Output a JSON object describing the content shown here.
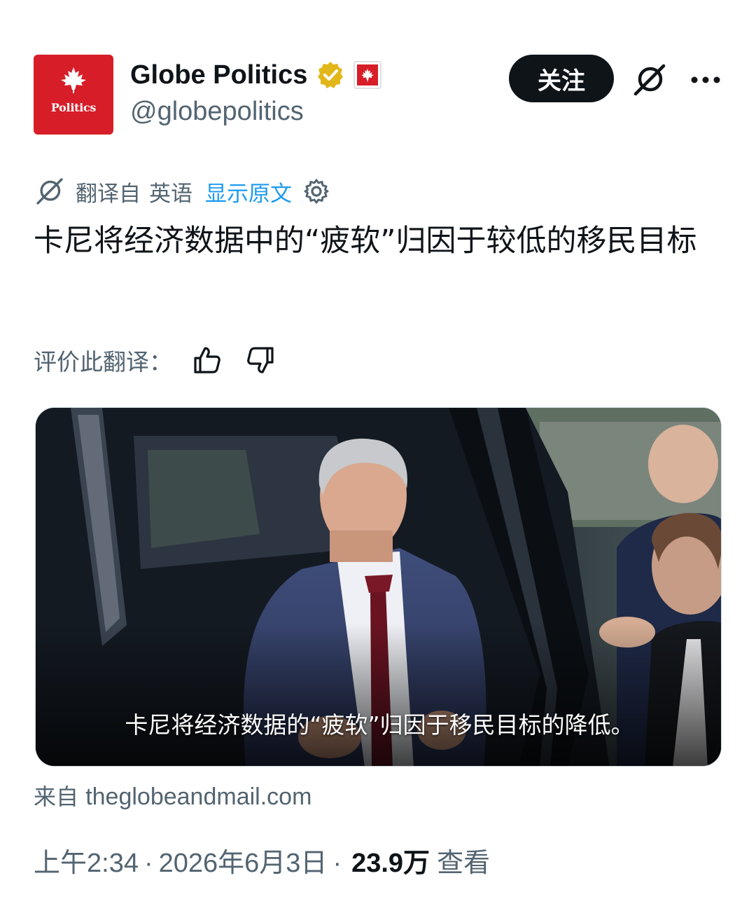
{
  "account": {
    "avatar_text": "Politics",
    "display_name": "Globe Politics",
    "handle": "@globepolitics",
    "verified_icon": "verified-badge-gold",
    "affiliate_icon": "canada-flag-badge",
    "brand_color": "#d71e28"
  },
  "actions": {
    "follow_label": "关注",
    "grok_icon": "grok-icon",
    "more_icon": "more-icon"
  },
  "translation": {
    "translated_from": "翻译自",
    "language": "英语",
    "show_original": "显示原文",
    "settings_icon": "gear-icon"
  },
  "post": {
    "text": "卡尼将经济数据中的“疲软”归因于较低的移民目标"
  },
  "rating": {
    "label": "评价此翻译：",
    "thumbs_up_icon": "thumbs-up-icon",
    "thumbs_down_icon": "thumbs-down-icon"
  },
  "media": {
    "caption": "卡尼将经济数据的“疲软”归因于移民目标的降低。"
  },
  "source": {
    "prefix": "来自",
    "domain": "theglobeandmail.com"
  },
  "meta": {
    "time": "上午2:34",
    "separator": "·",
    "date": "2026年6月3日",
    "views_count": "23.9万",
    "views_label": "查看"
  }
}
